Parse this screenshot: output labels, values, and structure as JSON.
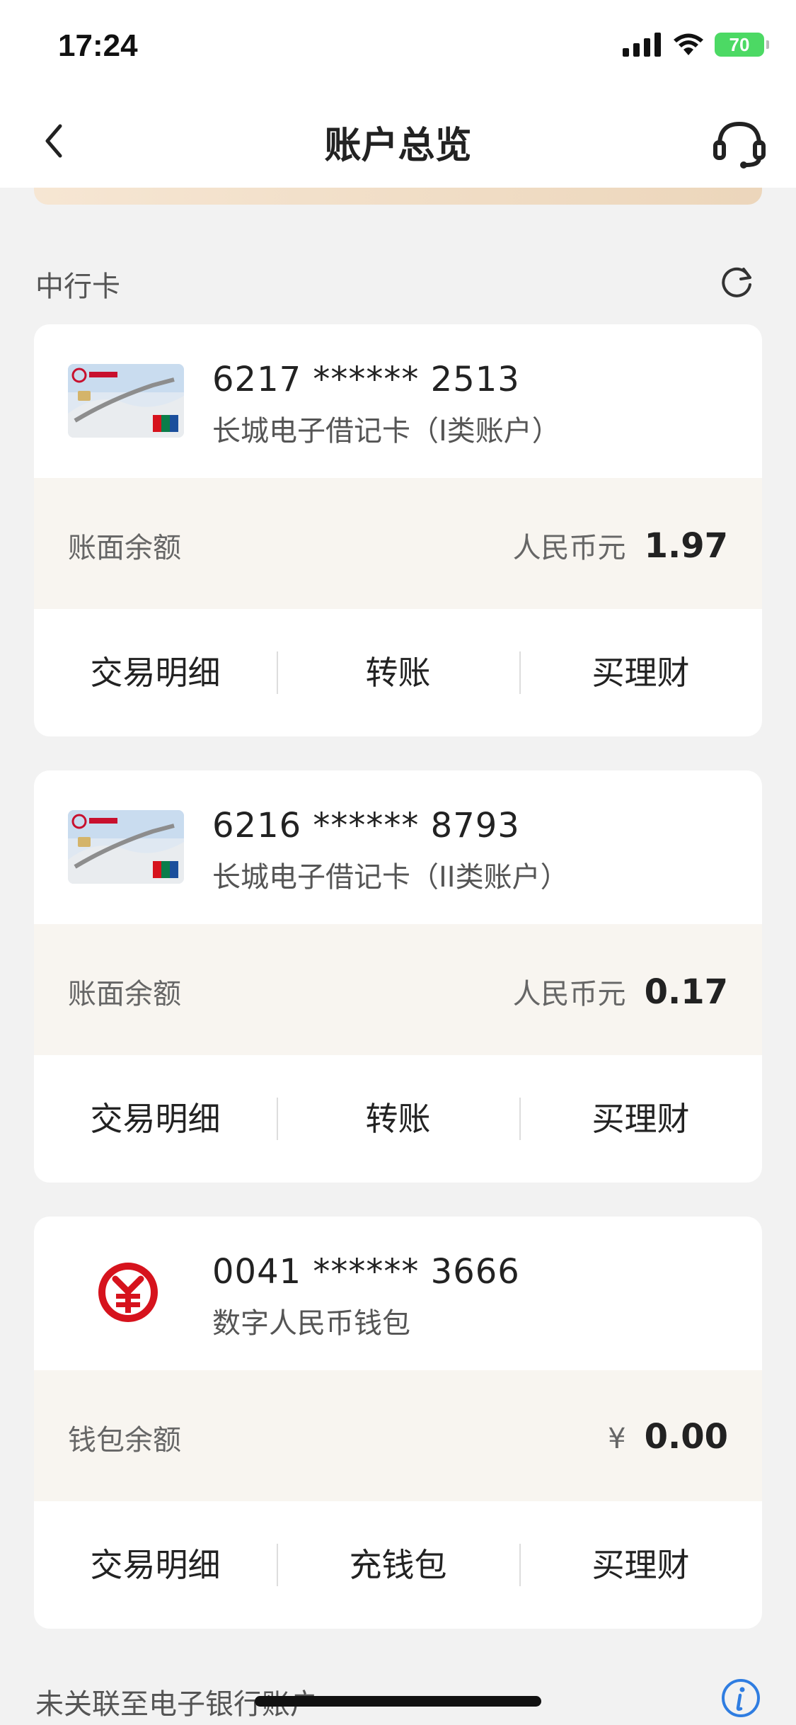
{
  "status_bar": {
    "time": "17:24",
    "battery": "70"
  },
  "nav": {
    "title": "账户总览"
  },
  "section": {
    "title": "中行卡"
  },
  "cards": [
    {
      "number": "6217 ****** 2513",
      "type": "长城电子借记卡（I类账户）",
      "balance_label": "账面余额",
      "currency": "人民币元",
      "balance": "1.97",
      "actions": [
        "交易明细",
        "转账",
        "买理财"
      ]
    },
    {
      "number": "6216 ****** 8793",
      "type": "长城电子借记卡（II类账户）",
      "balance_label": "账面余额",
      "currency": "人民币元",
      "balance": "0.17",
      "actions": [
        "交易明细",
        "转账",
        "买理财"
      ]
    },
    {
      "number": "0041 ****** 3666",
      "type": "数字人民币钱包",
      "balance_label": "钱包余额",
      "currency": "¥",
      "balance": "0.00",
      "actions": [
        "交易明细",
        "充钱包",
        "买理财"
      ]
    }
  ],
  "bottom_section": {
    "title": "未关联至电子银行账户"
  },
  "colors": {
    "brand_red": "#d6131d",
    "balance_bg": "#f8f5f0",
    "battery_green": "#4cd964",
    "info_blue": "#2f7de1"
  }
}
